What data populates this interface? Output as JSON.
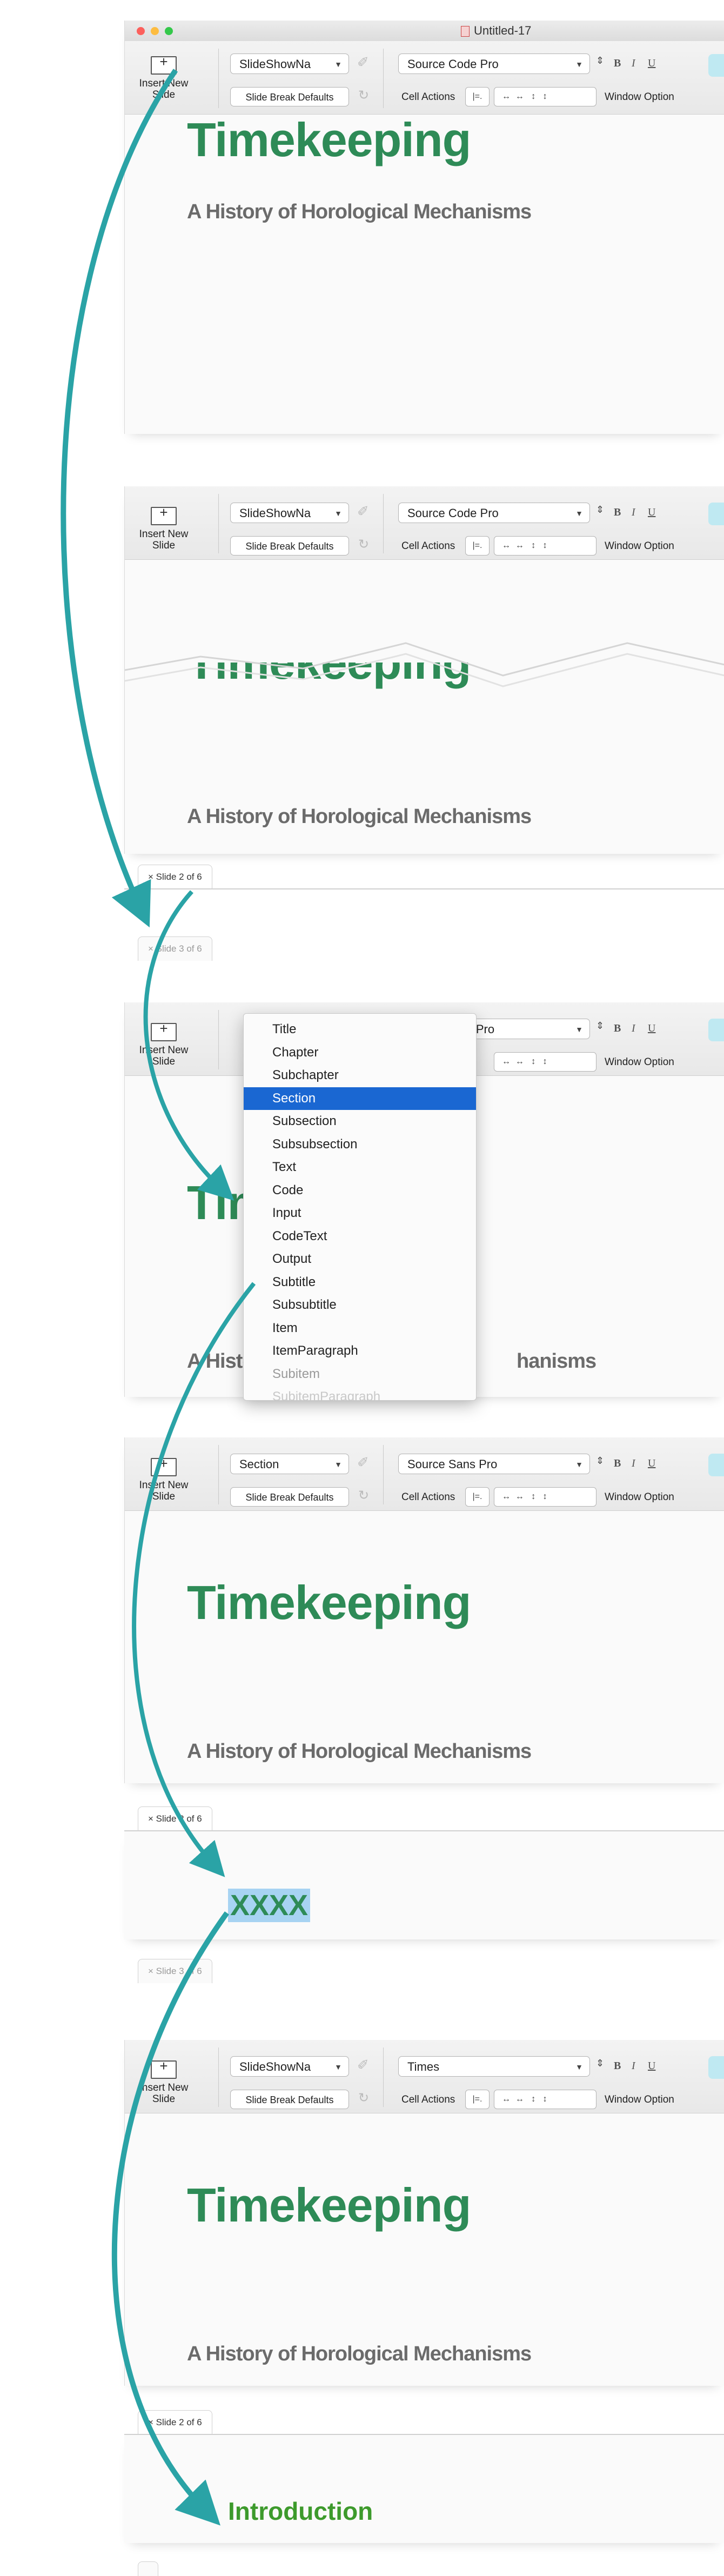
{
  "window": {
    "title": "Untitled-17"
  },
  "colors": {
    "accent_arrow": "#2aa3a6",
    "title_green": "#2e8b57",
    "subtitle_gray": "#6b6b6b",
    "menu_selected": "#1a67d2",
    "highlight": "#a7d3f2"
  },
  "toolbar": {
    "insert_label": "Insert New Slide",
    "slide_break_label": "Slide Break Defaults",
    "cell_actions_label": "Cell Actions",
    "window_option_label": "Window Option",
    "bold": "B",
    "italic": "I",
    "underline": "U"
  },
  "panels": [
    {
      "style_value": "SlideShowNa",
      "font_value": "Source Code Pro"
    },
    {
      "style_value": "SlideShowNa",
      "font_value": "Source Code Pro"
    },
    {
      "style_value": "",
      "font_value": "ode Pro"
    },
    {
      "style_value": "Section",
      "font_value": "Source Sans Pro"
    },
    {
      "style_value": "SlideShowNa",
      "font_value": "Times"
    }
  ],
  "slide": {
    "title": "Timekeeping",
    "subtitle": "A History of Horological Mechanisms"
  },
  "tabs": {
    "slide2": "× Slide  2  of  6",
    "slide3": "× Slide  3  of  6"
  },
  "style_menu": {
    "items": [
      "Title",
      "Chapter",
      "Subchapter",
      "Section",
      "Subsection",
      "Subsubsection",
      "Text",
      "Code",
      "Input",
      "CodeText",
      "Output",
      "Subtitle",
      "Subsubtitle",
      "Item",
      "ItemParagraph",
      "Subitem",
      "SubitemParagraph"
    ],
    "selected": "Section"
  },
  "panel3": {
    "partial_title": "Tim",
    "partial_subtitle_left": "A Histo",
    "partial_subtitle_right": "hanisms",
    "partial_insert": "Insert New Slide"
  },
  "new_cells": {
    "placeholder": "XXXX",
    "section": "Introduction"
  }
}
